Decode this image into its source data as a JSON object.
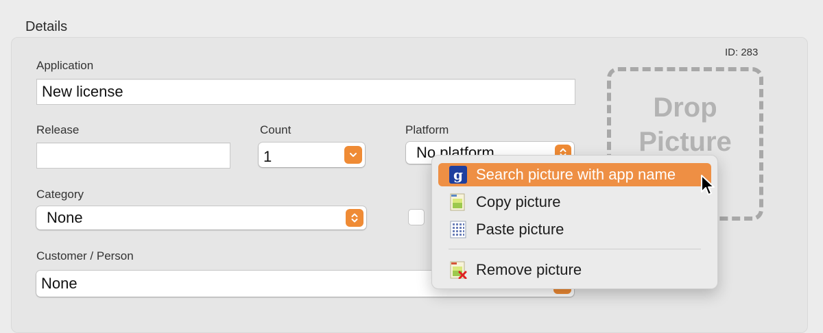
{
  "section": {
    "title": "Details"
  },
  "record": {
    "id_label": "ID: 283"
  },
  "fields": {
    "application": {
      "label": "Application",
      "value": "New license"
    },
    "release": {
      "label": "Release",
      "value": ""
    },
    "count": {
      "label": "Count",
      "value": "1"
    },
    "platform": {
      "label": "Platform",
      "value": "No platform"
    },
    "category": {
      "label": "Category",
      "value": "None"
    },
    "customer": {
      "label": "Customer / Person",
      "value": "None"
    }
  },
  "drop_zone": {
    "line1": "Drop",
    "line2": "Picture"
  },
  "context_menu": {
    "items": [
      {
        "label": "Search picture with app name",
        "icon": "google-icon",
        "highlighted": true
      },
      {
        "label": "Copy picture",
        "icon": "copy-document-icon"
      },
      {
        "label": "Paste picture",
        "icon": "paste-grid-icon"
      },
      {
        "label": "Remove picture",
        "icon": "remove-document-icon"
      }
    ]
  },
  "colors": {
    "accent": "#ef8b35",
    "highlight": "#ee8f44"
  }
}
